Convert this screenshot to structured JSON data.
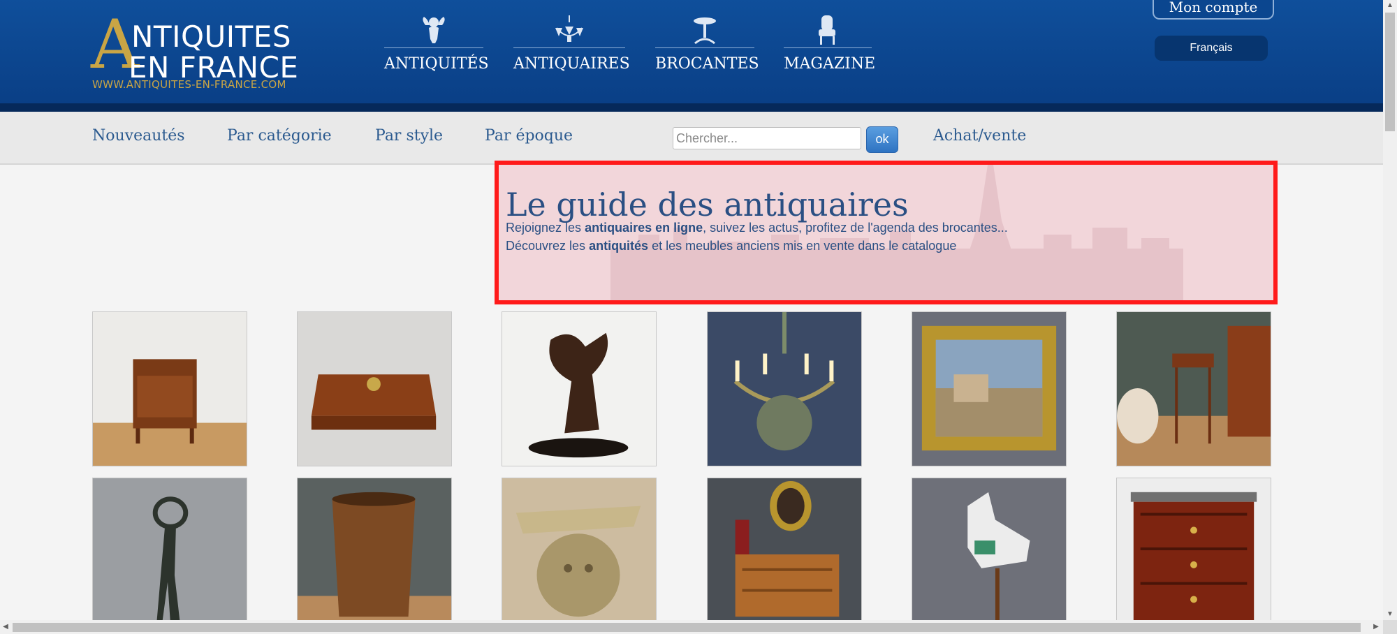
{
  "logo": {
    "letter": "A",
    "line1": "NTIQUITES",
    "line2": "EN FRANCE",
    "url": "WWW.ANTIQUITES-EN-FRANCE.COM"
  },
  "top_nav": [
    {
      "label": "ANTIQUITÉS",
      "icon": "cherub-icon"
    },
    {
      "label": "ANTIQUAIRES",
      "icon": "chandelier-icon"
    },
    {
      "label": "BROCANTES",
      "icon": "pedestal-table-icon"
    },
    {
      "label": "MAGAZINE",
      "icon": "armchair-icon"
    }
  ],
  "account": {
    "label": "Mon compte",
    "language": "Français"
  },
  "sub_nav": {
    "links": [
      "Nouveautés",
      "Par catégorie",
      "Par style",
      "Par époque"
    ],
    "search_placeholder": "Chercher...",
    "search_button": "ok",
    "achat_vente": "Achat/vente"
  },
  "guide": {
    "title": "Le guide des antiquaires",
    "line1": {
      "pre": "Rejoignez les ",
      "bold": "antiquaires en ligne",
      "post": ", suivez les actus, profitez de l'agenda des brocantes..."
    },
    "line2": {
      "pre": "Découvrez les ",
      "bold": "antiquités",
      "post": " et les meubles anciens mis en vente dans le catalogue"
    }
  },
  "products": [
    {
      "name": "nightstand-photo"
    },
    {
      "name": "burl-box-photo"
    },
    {
      "name": "bronze-sculpture-photo"
    },
    {
      "name": "chandelier-photo"
    },
    {
      "name": "framed-painting-photo"
    },
    {
      "name": "side-table-photo"
    },
    {
      "name": "bronze-figure-photo"
    },
    {
      "name": "leather-bin-photo"
    },
    {
      "name": "gilded-console-photo"
    },
    {
      "name": "chest-of-drawers-room-photo"
    },
    {
      "name": "carousel-horse-photo"
    },
    {
      "name": "mahogany-commode-photo"
    }
  ],
  "colors": {
    "header": "#0a3f86",
    "accent_gold": "#c9a545",
    "link": "#2b5a8f",
    "highlight_border": "#ff1a1a"
  }
}
